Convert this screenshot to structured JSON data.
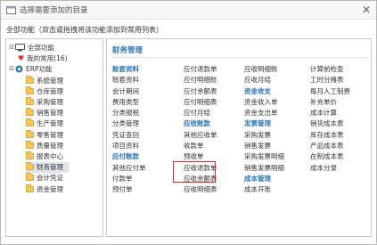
{
  "window": {
    "title": "选择需要添加的目录",
    "close_glyph": "✕"
  },
  "instruction": "全部功能（双击或拖拽将该功能添加到常用列表）",
  "tree": {
    "root": "全部功能",
    "favorites": "我的常用(16)",
    "erp": "ERP功能",
    "modules": [
      "系统管理",
      "仓库管理",
      "采购管理",
      "销售管理",
      "生产管理",
      "零售管理",
      "质量管理",
      "报表中心",
      "财务管理",
      "会计凭证",
      "资金管理"
    ],
    "selected": "财务管理"
  },
  "content": {
    "header": "财务管理",
    "col1": [
      {
        "label": "账套资料",
        "cat": true
      },
      {
        "label": "账套资料"
      },
      {
        "label": "会计期间"
      },
      {
        "label": "费用类型"
      },
      {
        "label": "分类报税"
      },
      {
        "label": "分类管理"
      },
      {
        "label": "凭证查回"
      },
      {
        "label": "项目资料"
      },
      {
        "label": "应付账款",
        "cat": true
      },
      {
        "label": "其他应付单"
      },
      {
        "label": "付款单"
      },
      {
        "label": "预付单"
      }
    ],
    "col2": [
      {
        "label": "应付退款单"
      },
      {
        "label": "应付明细账"
      },
      {
        "label": "应付余额表"
      },
      {
        "label": "应付明细表"
      },
      {
        "label": "应付月结"
      },
      {
        "label": "应收账款",
        "cat": true
      },
      {
        "label": "其他应收单"
      },
      {
        "label": "收款单"
      },
      {
        "label": "预收单"
      },
      {
        "label": "应收退款单"
      },
      {
        "label": "应收余额表"
      },
      {
        "label": "应收明细表"
      }
    ],
    "col3": [
      {
        "label": "应收明细账"
      },
      {
        "label": "应收月结"
      },
      {
        "label": "资金收支",
        "cat": true
      },
      {
        "label": "资金收入单"
      },
      {
        "label": "资金支出单"
      },
      {
        "label": "发票管理",
        "cat": true
      },
      {
        "label": "采购发票"
      },
      {
        "label": "销售发票"
      },
      {
        "label": "采购发票明细"
      },
      {
        "label": "销售发票明细"
      },
      {
        "label": "成本管理",
        "cat": true
      },
      {
        "label": "成本开账"
      }
    ],
    "col4": [
      {
        "label": "计算前检查"
      },
      {
        "label": "工时分摊表"
      },
      {
        "label": "每月人工制费"
      },
      {
        "label": "补充单价"
      },
      {
        "label": "成本计算"
      },
      {
        "label": "销货成本表"
      },
      {
        "label": "库存成本表"
      },
      {
        "label": "产品成本表"
      },
      {
        "label": "在制成本表"
      },
      {
        "label": "成本分录"
      }
    ],
    "highlighted_item": "预收单"
  },
  "colors": {
    "accent": "#2e75b6",
    "highlight": "#e0262c",
    "folder": "#f3c85a"
  }
}
